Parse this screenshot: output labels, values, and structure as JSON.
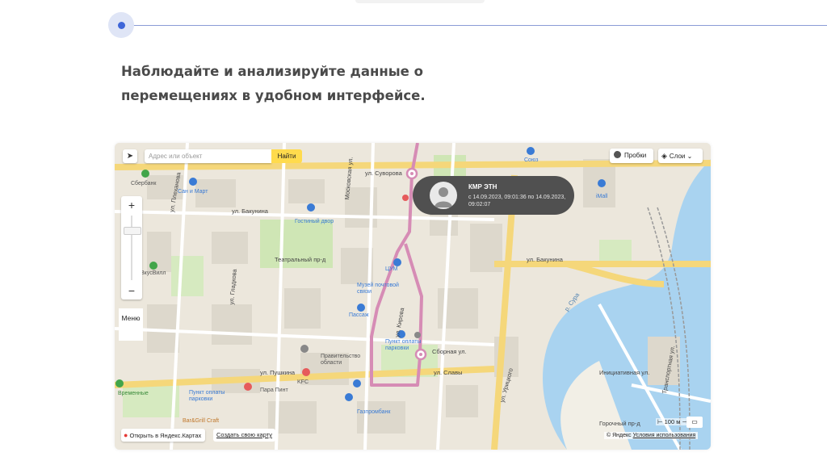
{
  "headline": {
    "line1": "Наблюдайте и анализируйте данные о",
    "line2": "перемещениях в удобном интерфейсе."
  },
  "map": {
    "search_placeholder": "Адрес или объект",
    "search_button": "Найти",
    "traffic_button": "Пробки",
    "layers_button": "Слои",
    "menu_button": "Меню",
    "tooltip": {
      "name": "КМР ЭТН",
      "period": "с 14.09.2023, 09:01:36 по 14.09.2023, 09:02:07"
    },
    "open_in_yandex": "Открыть в Яндекс.Картах",
    "create_map": "Создать свою карту",
    "scale": "100 м",
    "copyright_brand": "© Яндекс",
    "copyright_terms": "Условия использования",
    "streets": {
      "suvorova": "ул. Суворова",
      "bakunina_left": "ул. Бакунина",
      "bakunina_right": "ул. Бакунина",
      "pushkina": "ул. Пушкина",
      "slavy": "ул. Славы",
      "uritskogo": "ул. Урицкого",
      "teatralny": "Театральный пр-д",
      "sbornaya": "Сборная ул.",
      "kirova": "ул. Кирова",
      "moskovskaya": "Московская ул.",
      "plekhanova": "ул. Плеханова",
      "gladkova": "ул. Гладкова",
      "inzhenernaya": "Инициативная ул.",
      "transportnaya": "Транспортная ул.",
      "gorochny": "Горочный пр-д",
      "sura": "р. Сура"
    },
    "places": {
      "sberbank": "Сбербанк",
      "sanmart": "Сан и Март",
      "gostiny": "Гостиный двор",
      "vkusvill": "ВкусВилл",
      "tsum": "ЦУМ",
      "museum": "Музей почтовой связи",
      "passage": "Пассаж",
      "parking1": "Пункт оплаты парковки",
      "pravitelstvo": "Правительство области",
      "kfc": "KFC",
      "para_pint": "Пара Пинт",
      "parking2": "Пункт оплаты парковки",
      "bargrill": "Bar&Grill Craft",
      "gazprombank": "Газпромбанк",
      "souz": "Союз",
      "imall": "iMall",
      "vremennye": "Временные"
    }
  }
}
